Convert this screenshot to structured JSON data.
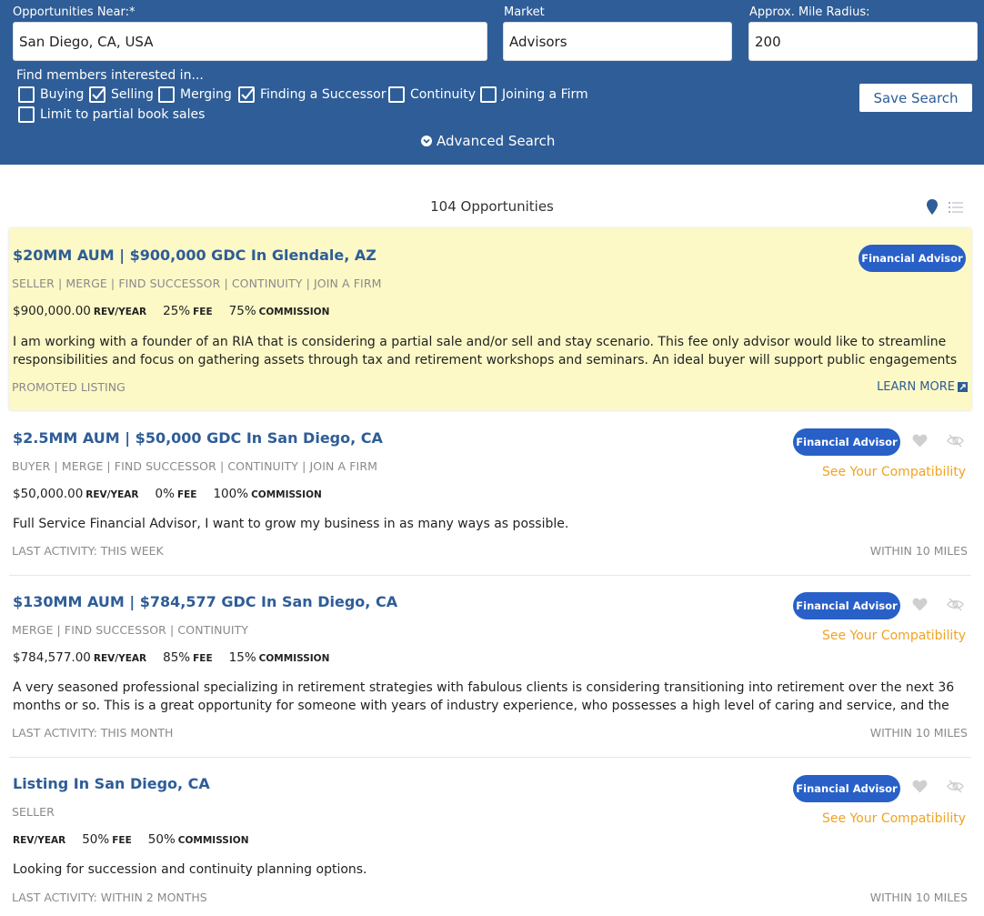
{
  "search": {
    "location_label": "Opportunities Near:*",
    "location_value": "San Diego, CA, USA",
    "market_label": "Market",
    "market_value": "Advisors",
    "radius_label": "Approx. Mile Radius:",
    "radius_value": "200",
    "find_label": "Find members interested in...",
    "options": [
      {
        "label": "Buying",
        "checked": false
      },
      {
        "label": "Selling",
        "checked": true
      },
      {
        "label": "Merging",
        "checked": false
      },
      {
        "label": "Finding a Successor",
        "checked": true
      },
      {
        "label": "Continuity",
        "checked": false
      },
      {
        "label": "Joining a Firm",
        "checked": false
      },
      {
        "label": "Limit to partial book sales",
        "checked": false
      }
    ],
    "save_label": "Save Search",
    "advanced_label": "Advanced Search"
  },
  "results": {
    "count_label": "104 Opportunities"
  },
  "listings": [
    {
      "title": "$20MM AUM | $900,000 GDC In Glendale, AZ",
      "roles": "SELLER | MERGE | FIND SUCCESSOR | CONTINUITY | JOIN A FIRM",
      "revenue": "$900,000.00",
      "revenue_unit": "REV/YEAR",
      "fee": "25%",
      "fee_unit": "FEE",
      "commission": "75%",
      "commission_unit": "COMMISSION",
      "description": "I am working with a founder of an RIA that is considering a partial sale and/or sell and stay scenario. This fee only advisor would like to streamline responsibilities and focus on gathering assets through tax and retirement workshops and seminars. An ideal buyer will support public engagements and",
      "footer_left": "PROMOTED LISTING",
      "learn_more": "LEARN MORE",
      "badge": "Financial Advisor",
      "promoted": true
    },
    {
      "title": "$2.5MM AUM | $50,000 GDC In San Diego, CA",
      "roles": "BUYER | MERGE | FIND SUCCESSOR | CONTINUITY | JOIN A FIRM",
      "revenue": "$50,000.00",
      "revenue_unit": "REV/YEAR",
      "fee": "0%",
      "fee_unit": "FEE",
      "commission": "100%",
      "commission_unit": "COMMISSION",
      "description": "Full Service Financial Advisor, I want to grow my business in as many ways as possible.",
      "footer_left": "LAST ACTIVITY: THIS WEEK",
      "footer_right": "WITHIN 10 MILES",
      "badge": "Financial Advisor",
      "compatibility": "See Your Compatibility"
    },
    {
      "title": "$130MM AUM | $784,577 GDC In San Diego, CA",
      "roles": "MERGE | FIND SUCCESSOR | CONTINUITY",
      "revenue": "$784,577.00",
      "revenue_unit": "REV/YEAR",
      "fee": "85%",
      "fee_unit": "FEE",
      "commission": "15%",
      "commission_unit": "COMMISSION",
      "description": "A very seasoned professional specializing in retirement strategies with fabulous clients is considering transitioning into retirement over the next 36 months or so. This is a great opportunity for someone with years of industry experience, who possesses a high level of caring and service, and the technical/people",
      "footer_left": "LAST ACTIVITY: THIS MONTH",
      "footer_right": "WITHIN 10 MILES",
      "badge": "Financial Advisor",
      "compatibility": "See Your Compatibility"
    },
    {
      "title": "Listing In San Diego, CA",
      "roles": "SELLER",
      "revenue": "",
      "revenue_unit": "REV/YEAR",
      "fee": "50%",
      "fee_unit": "FEE",
      "commission": "50%",
      "commission_unit": "COMMISSION",
      "description": "Looking for succession and continuity planning options.",
      "footer_left": "LAST ACTIVITY: WITHIN 2 MONTHS",
      "footer_right": "WITHIN 10 MILES",
      "badge": "Financial Advisor",
      "compatibility": "See Your Compatibility"
    }
  ],
  "colors": {
    "header_bg": "#2e5d97",
    "link_blue": "#2e5d97",
    "badge_blue": "#2860c8",
    "promoted_bg": "#fcf9c7",
    "compat_orange": "#f0a323",
    "muted_gray": "#8a8a8a"
  },
  "icons": {
    "advanced": "chevron-down-circle-icon",
    "map": "map-pin-icon",
    "list": "list-view-icon",
    "external": "external-link-icon",
    "favorite": "heart-icon",
    "hide": "eye-slash-icon",
    "check": "checkmark-icon"
  }
}
